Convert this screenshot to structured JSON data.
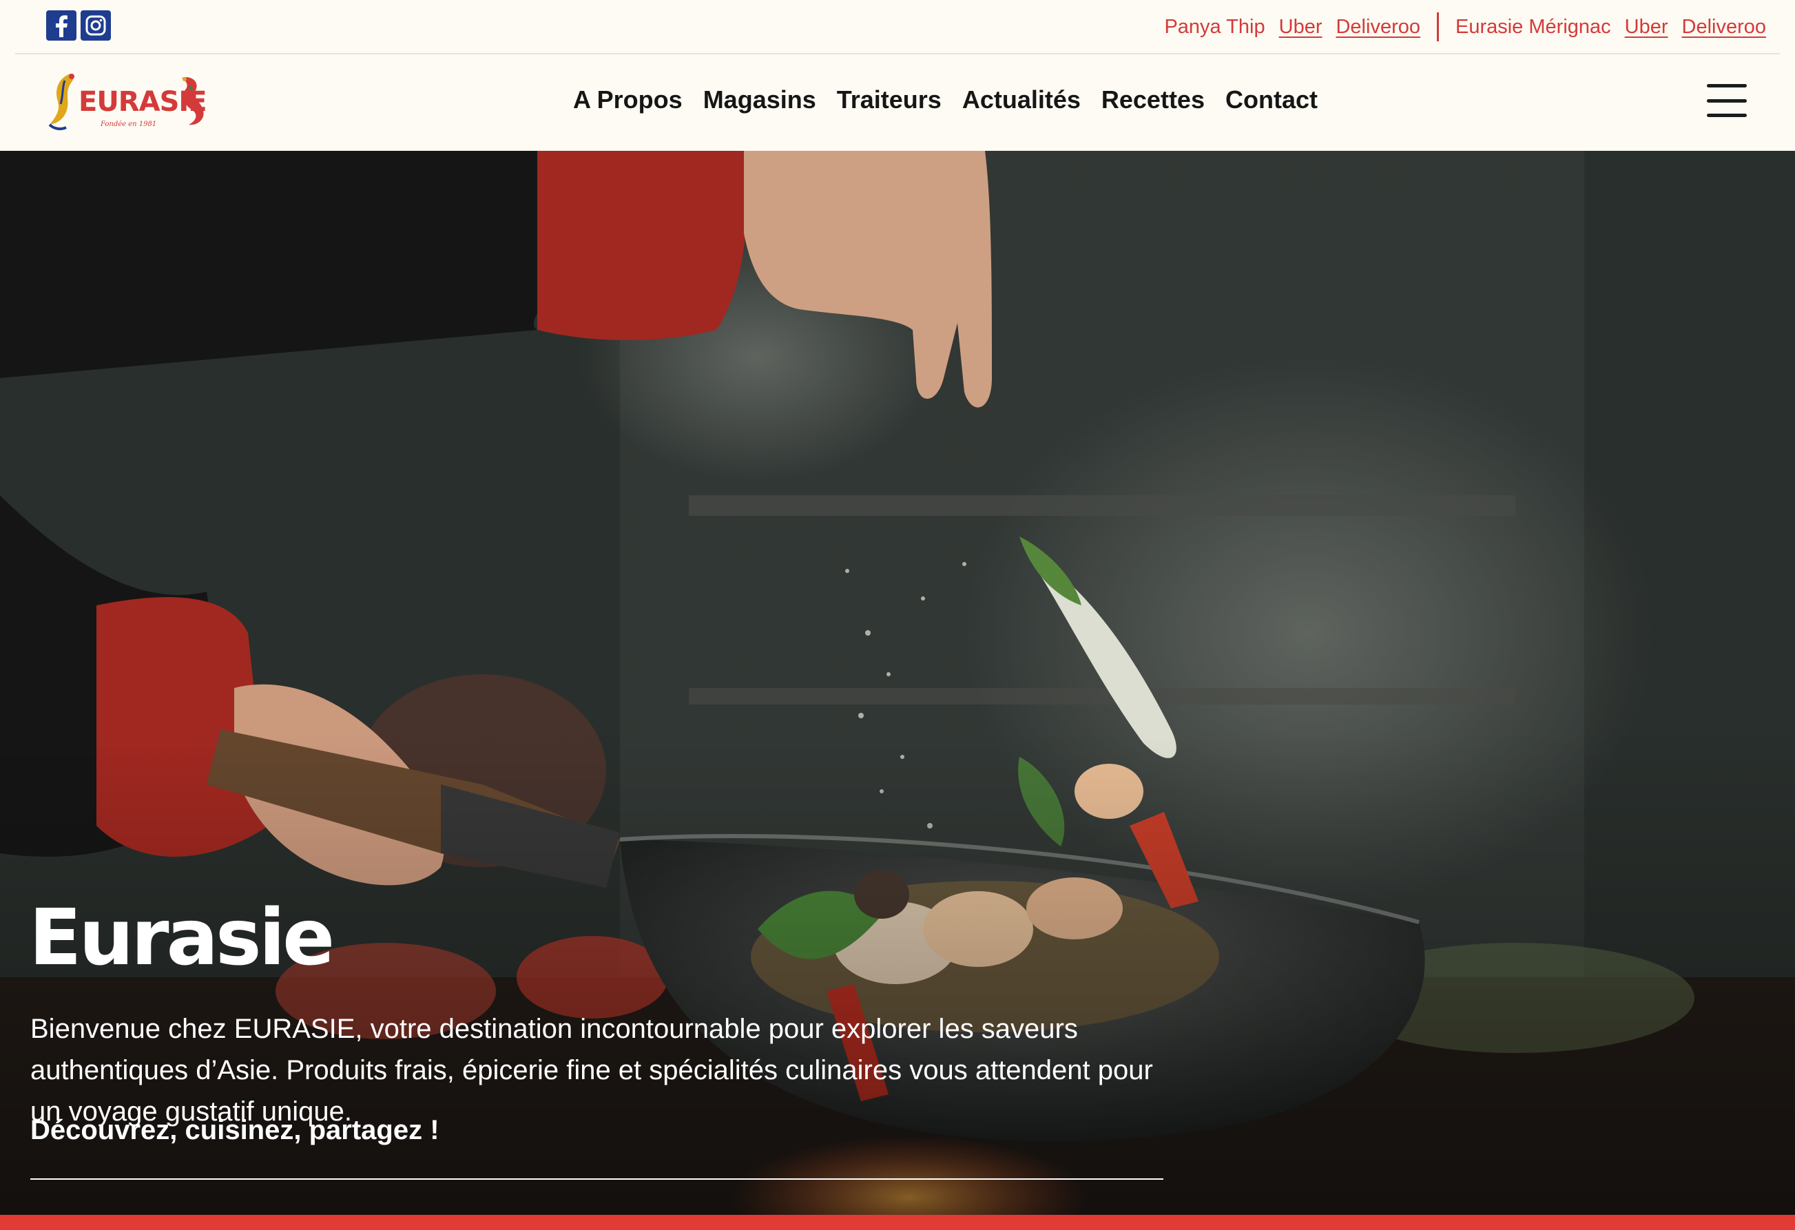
{
  "topbar": {
    "social": [
      {
        "icon": "facebook-icon",
        "color": "#1e3d8f"
      },
      {
        "icon": "instagram-icon",
        "color": "#1e3d8f"
      }
    ],
    "shops": [
      {
        "name": "Panya Thip",
        "links": [
          "Uber",
          "Deliveroo"
        ]
      },
      {
        "name": "Eurasie Mérignac",
        "links": [
          "Uber",
          "Deliveroo"
        ]
      }
    ],
    "accent_color": "#d43a3a"
  },
  "logo": {
    "brand": "EURASIE",
    "tagline": "Fondée en 1981"
  },
  "nav": {
    "items": [
      "A Propos",
      "Magasins",
      "Traiteurs",
      "Actualités",
      "Recettes",
      "Contact"
    ],
    "menu_icon": "hamburger-menu-icon"
  },
  "hero": {
    "title": "Eurasie",
    "text": "Bienvenue chez EURASIE, votre destination incontournable pour explorer les saveurs authentiques d’Asie. Produits frais, épicerie fine et spécialités culinaires vous attendent pour un voyage gustatif unique.",
    "cta": "Découvrez, cuisinez, partagez !"
  },
  "colors": {
    "background": "#fdfbf3",
    "brand_red": "#e03b35",
    "brand_blue": "#1e3d8f"
  }
}
